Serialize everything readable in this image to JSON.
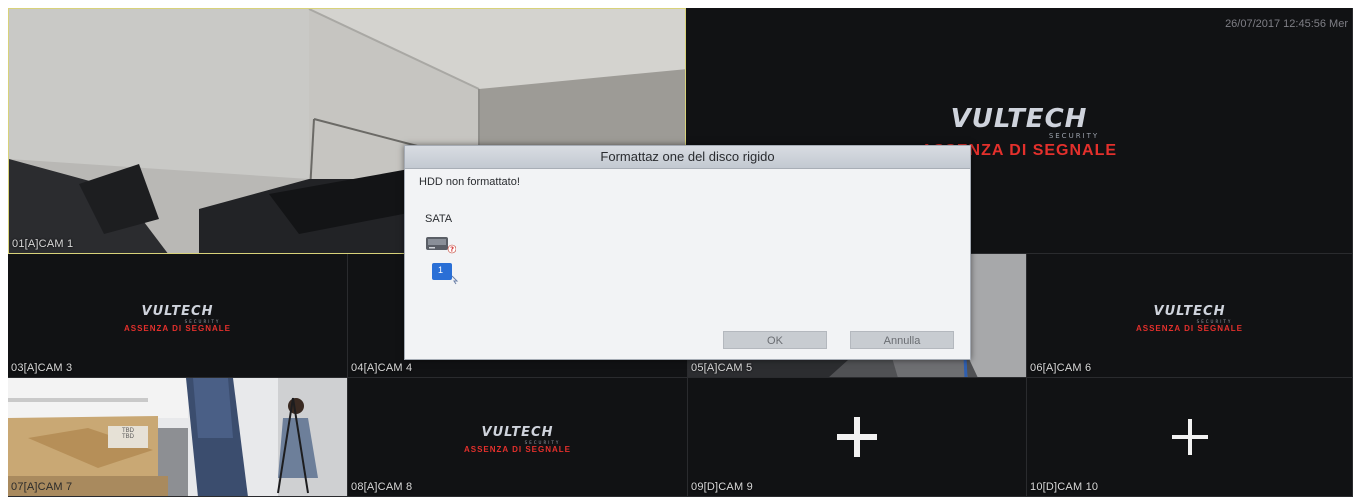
{
  "timestamp": "26/07/2017 12:45:56 Mer",
  "brand": {
    "logo_text": "VULTECH",
    "logo_sub": "SECURITY",
    "no_signal": "ASSENZA DI SEGNALE"
  },
  "tiles": [
    {
      "label": "01[A]CAM 1"
    },
    {
      "label": ""
    },
    {
      "label": "03[A]CAM 3"
    },
    {
      "label": "04[A]CAM 4"
    },
    {
      "label": "05[A]CAM 5"
    },
    {
      "label": "06[A]CAM 6"
    },
    {
      "label": "07[A]CAM 7"
    },
    {
      "label": "08[A]CAM 8"
    },
    {
      "label": "09[D]CAM 9"
    },
    {
      "label": "10[D]CAM 10"
    }
  ],
  "scene_text": {
    "box_label": "TBD\nTBD"
  },
  "dialog": {
    "title": "Formattaz one del disco rigido",
    "message": "HDD non formattato!",
    "group_label": "SATA",
    "disk_number": "1",
    "ok_label": "OK",
    "cancel_label": "Annulla"
  },
  "colors": {
    "no_signal": "#e4302c",
    "selected_border": "#d8d27a",
    "dialog_title_bg": "#c3c9d1",
    "disk_badge": "#2a6fd6"
  }
}
